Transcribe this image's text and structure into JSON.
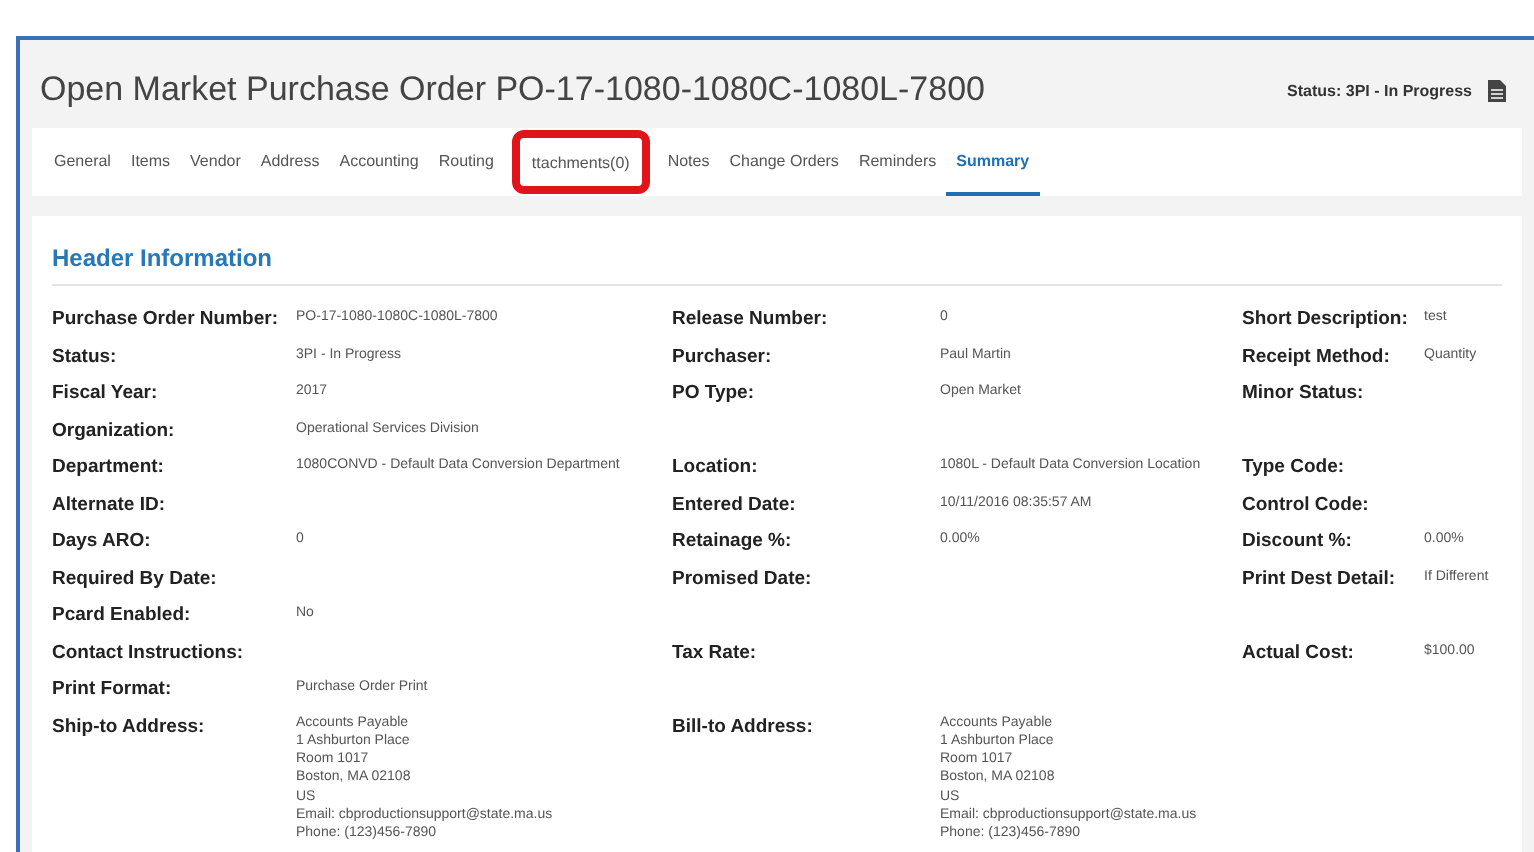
{
  "window": {
    "title": "Open Market Purchase Order PO-17-1080-1080C-1080L-7800",
    "status": "Status: 3PI - In Progress"
  },
  "tabs": [
    {
      "label": "General",
      "selected": false
    },
    {
      "label": "Items",
      "selected": false
    },
    {
      "label": "Vendor",
      "selected": false
    },
    {
      "label": "Address",
      "selected": false
    },
    {
      "label": "Accounting",
      "selected": false
    },
    {
      "label": "Routing",
      "selected": false
    },
    {
      "label": "ttachments(0)",
      "selected": false,
      "highlighted": true
    },
    {
      "label": "Notes",
      "selected": false
    },
    {
      "label": "Change Orders",
      "selected": false
    },
    {
      "label": "Reminders",
      "selected": false
    },
    {
      "label": "Summary",
      "selected": true
    }
  ],
  "section": {
    "title": "Header Information"
  },
  "rows": [
    {
      "left": {
        "label": "Purchase Order Number:",
        "value": "PO-17-1080-1080C-1080L-7800"
      },
      "middle": {
        "label": "Release Number:",
        "value": "0"
      },
      "right": {
        "label": "Short Description:",
        "value": "test"
      }
    },
    {
      "left": {
        "label": "Status:",
        "value": "3PI - In Progress"
      },
      "middle": {
        "label": "Purchaser:",
        "value": "Paul Martin"
      },
      "right": {
        "label": "Receipt Method:",
        "value": "Quantity"
      }
    },
    {
      "left": {
        "label": "Fiscal Year:",
        "value": "2017"
      },
      "middle": {
        "label": "PO Type:",
        "value": "Open Market"
      },
      "right": {
        "label": "Minor Status:"
      }
    },
    {
      "left": {
        "label": "Organization:",
        "value": "Operational Services Division"
      }
    },
    {
      "left": {
        "label": "Department:",
        "value": "1080CONVD - Default Data Conversion Department"
      },
      "middle": {
        "label": "Location:",
        "value": "1080L - Default Data Conversion Location"
      },
      "right": {
        "label": "Type Code:"
      }
    },
    {
      "left": {
        "label": "Alternate ID:"
      },
      "middle": {
        "label": "Entered Date:",
        "value": "10/11/2016 08:35:57 AM"
      },
      "right": {
        "label": "Control Code:"
      }
    },
    {
      "left": {
        "label": "Days ARO:",
        "value": "0"
      },
      "middle": {
        "label": "Retainage %:",
        "value": "0.00%"
      },
      "right": {
        "label": "Discount %:",
        "value": "0.00%"
      }
    },
    {
      "left": {
        "label": "Required By Date:"
      },
      "middle": {
        "label": "Promised Date:"
      },
      "right": {
        "label": "Print Dest Detail:",
        "value": "If Different"
      }
    },
    {
      "left": {
        "label": "Pcard Enabled:",
        "value": "No"
      }
    },
    {
      "left": {
        "label": "Contact Instructions:"
      },
      "middle": {
        "label": "Tax Rate:"
      },
      "right": {
        "label": "Actual Cost:",
        "value": "$100.00"
      }
    },
    {
      "left": {
        "label": "Print Format:",
        "value": "Purchase Order Print"
      }
    },
    {
      "left": {
        "label": "Ship-to Address:",
        "lines": [
          "Accounts Payable",
          "1 Ashburton Place",
          "Room 1017",
          "Boston, MA 02108",
          "US",
          "Email: cbproductionsupport@state.ma.us",
          "Phone: (123)456-7890"
        ]
      },
      "middle": {
        "label": "Bill-to Address:",
        "lines": [
          "Accounts Payable",
          "1 Ashburton Place",
          "Room 1017",
          "Boston, MA 02108",
          "US",
          "Email: cbproductionsupport@state.ma.us",
          "Phone: (123)456-7890"
        ]
      }
    }
  ]
}
